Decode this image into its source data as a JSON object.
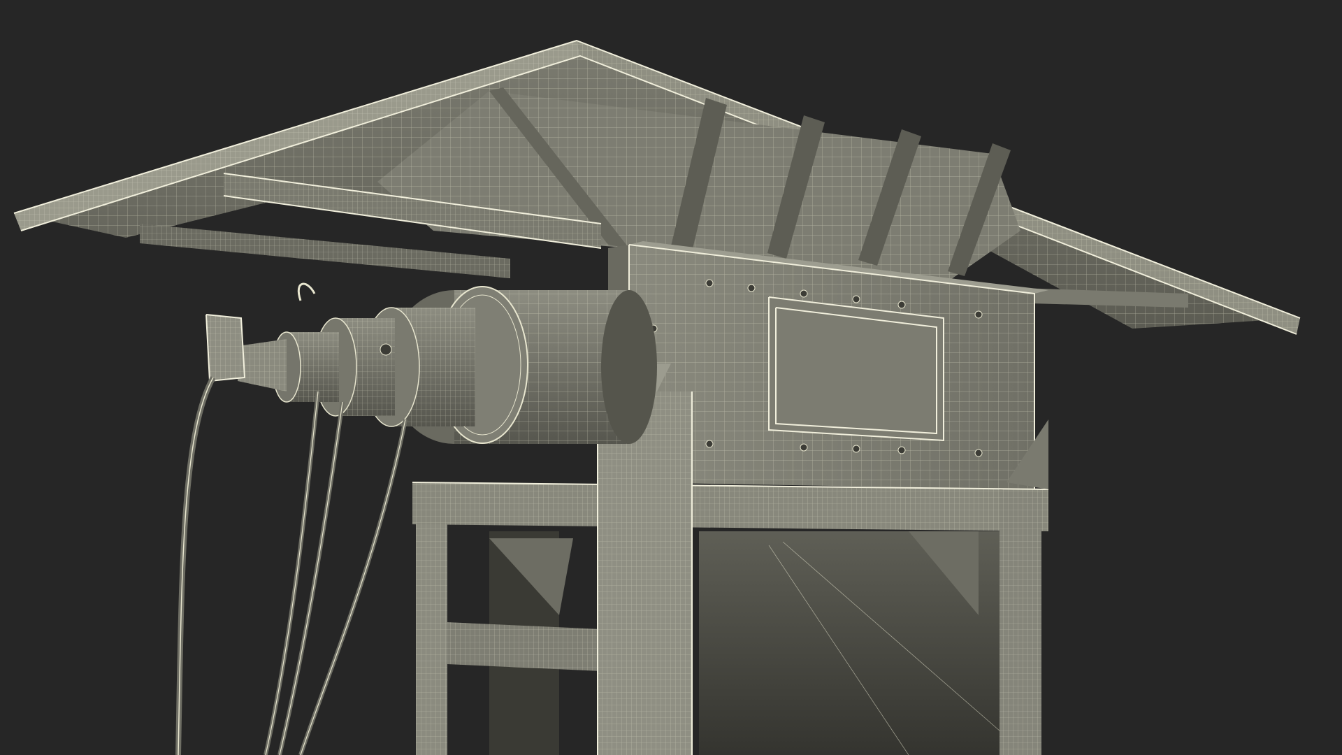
{
  "scene": {
    "subject": "wireframe-render-machine",
    "colors": {
      "background": "#262626",
      "surface_light": "#86867a",
      "surface_mid": "#6f6f64",
      "surface_dark": "#4b4b43",
      "wire": "#e8e6cf"
    }
  }
}
